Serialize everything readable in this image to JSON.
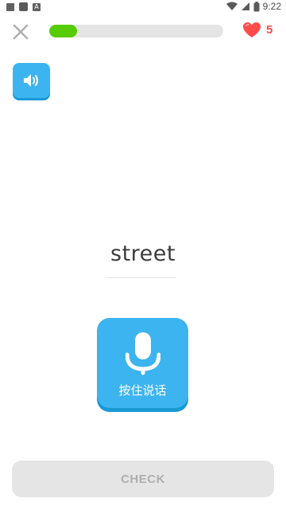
{
  "status_bar": {
    "time": "9:22",
    "icons": [
      "image-icon",
      "square-icon",
      "a-icon",
      "wifi-icon",
      "signal-icon",
      "battery-icon"
    ],
    "a_glyph": "A"
  },
  "header": {
    "close_icon": "close-icon",
    "progress": 0.16,
    "hearts_count": "5",
    "colors": {
      "progress_fill": "#58cc02",
      "progress_track": "#e5e5e5",
      "heart": "#ff4b4b"
    }
  },
  "exercise": {
    "speaker_icon": "speaker-icon",
    "word": "street",
    "mic_icon": "microphone-icon",
    "mic_label": "按住说话"
  },
  "footer": {
    "check_label": "CHECK"
  },
  "colors": {
    "primary": "#3cb4f0",
    "primary_shadow": "#1899d6",
    "disabled_bg": "#e5e5e5",
    "disabled_text": "#afafaf"
  }
}
